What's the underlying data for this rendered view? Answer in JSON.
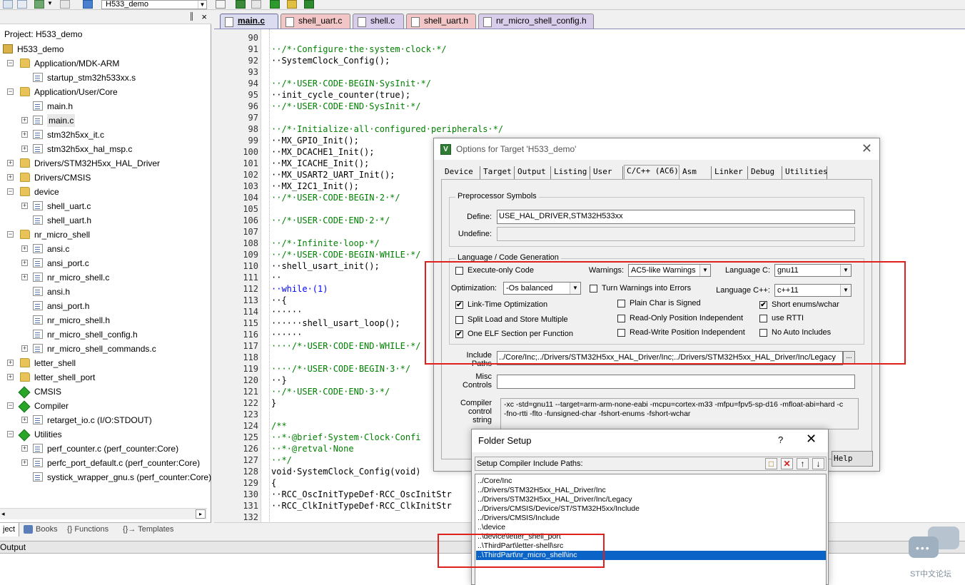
{
  "toolbar": {
    "target_combo": "H533_demo"
  },
  "project_pane": {
    "pin": "║",
    "close": "×",
    "title": "Project: H533_demo",
    "tree": [
      {
        "label": "H533_demo",
        "indent": 0,
        "icon": "project-icon",
        "expander": ""
      },
      {
        "label": "Application/MDK-ARM",
        "indent": 1,
        "icon": "folder-icon",
        "expander": "−"
      },
      {
        "label": "startup_stm32h533xx.s",
        "indent": 2,
        "icon": "file-icon",
        "expander": ""
      },
      {
        "label": "Application/User/Core",
        "indent": 1,
        "icon": "folder-icon",
        "expander": "−"
      },
      {
        "label": "main.h",
        "indent": 2,
        "icon": "file-icon",
        "expander": ""
      },
      {
        "label": "main.c",
        "indent": 2,
        "icon": "file-icon",
        "expander": "+",
        "selected": true
      },
      {
        "label": "stm32h5xx_it.c",
        "indent": 2,
        "icon": "file-icon",
        "expander": "+"
      },
      {
        "label": "stm32h5xx_hal_msp.c",
        "indent": 2,
        "icon": "file-icon",
        "expander": "+"
      },
      {
        "label": "Drivers/STM32H5xx_HAL_Driver",
        "indent": 1,
        "icon": "folder-icon",
        "expander": "+"
      },
      {
        "label": "Drivers/CMSIS",
        "indent": 1,
        "icon": "folder-icon",
        "expander": "+"
      },
      {
        "label": "device",
        "indent": 1,
        "icon": "folder-icon",
        "expander": "−"
      },
      {
        "label": "shell_uart.c",
        "indent": 2,
        "icon": "file-icon",
        "expander": "+"
      },
      {
        "label": "shell_uart.h",
        "indent": 2,
        "icon": "file-icon",
        "expander": ""
      },
      {
        "label": "nr_micro_shell",
        "indent": 1,
        "icon": "folder-icon",
        "expander": "−"
      },
      {
        "label": "ansi.c",
        "indent": 2,
        "icon": "file-icon",
        "expander": "+"
      },
      {
        "label": "ansi_port.c",
        "indent": 2,
        "icon": "file-icon",
        "expander": "+"
      },
      {
        "label": "nr_micro_shell.c",
        "indent": 2,
        "icon": "file-icon",
        "expander": "+"
      },
      {
        "label": "ansi.h",
        "indent": 2,
        "icon": "file-icon",
        "expander": ""
      },
      {
        "label": "ansi_port.h",
        "indent": 2,
        "icon": "file-icon",
        "expander": ""
      },
      {
        "label": "nr_micro_shell.h",
        "indent": 2,
        "icon": "file-icon",
        "expander": ""
      },
      {
        "label": "nr_micro_shell_config.h",
        "indent": 2,
        "icon": "file-icon",
        "expander": ""
      },
      {
        "label": "nr_micro_shell_commands.c",
        "indent": 2,
        "icon": "file-icon",
        "expander": "+"
      },
      {
        "label": "letter_shell",
        "indent": 1,
        "icon": "folder-icon",
        "expander": "+"
      },
      {
        "label": "letter_shell_port",
        "indent": 1,
        "icon": "folder-icon",
        "expander": "+"
      },
      {
        "label": "CMSIS",
        "indent": 1,
        "icon": "diamond-icon",
        "expander": ""
      },
      {
        "label": "Compiler",
        "indent": 1,
        "icon": "diamond-icon",
        "expander": "−"
      },
      {
        "label": "retarget_io.c (I/O:STDOUT)",
        "indent": 2,
        "icon": "file-icon",
        "expander": "+"
      },
      {
        "label": "Utilities",
        "indent": 1,
        "icon": "diamond-icon",
        "expander": "−"
      },
      {
        "label": "perf_counter.c (perf_counter:Core)",
        "indent": 2,
        "icon": "file-icon",
        "expander": "+"
      },
      {
        "label": "perfc_port_default.c (perf_counter:Core)",
        "indent": 2,
        "icon": "file-icon",
        "expander": "+"
      },
      {
        "label": "systick_wrapper_gnu.s (perf_counter:Core)",
        "indent": 2,
        "icon": "file-icon",
        "expander": ""
      }
    ],
    "bottom_tabs": [
      "ject",
      "Books",
      "{} Functions",
      "{}→ Templates"
    ]
  },
  "output": {
    "label": "Output"
  },
  "editor": {
    "tabs": [
      "main.c",
      "shell_uart.c",
      "shell.c",
      "shell_uart.h",
      "nr_micro_shell_config.h"
    ],
    "tab_colors": [
      "#dcdcf0",
      "#f2c6c6",
      "#d8cdea",
      "#f2c6c6",
      "#d8cdea"
    ],
    "lines": [
      {
        "n": "90",
        "t": ""
      },
      {
        "n": "91",
        "t": "··/*·Configure·the·system·clock·*/",
        "c": "cm"
      },
      {
        "n": "92",
        "t": "··SystemClock_Config();"
      },
      {
        "n": "93",
        "t": ""
      },
      {
        "n": "94",
        "t": "··/*·USER·CODE·BEGIN·SysInit·*/",
        "c": "cm"
      },
      {
        "n": "95",
        "t": "··init_cycle_counter(true);"
      },
      {
        "n": "96",
        "t": "··/*·USER·CODE·END·SysInit·*/",
        "c": "cm"
      },
      {
        "n": "97",
        "t": ""
      },
      {
        "n": "98",
        "t": "··/*·Initialize·all·configured·peripherals·*/",
        "c": "cm"
      },
      {
        "n": "99",
        "t": "··MX_GPIO_Init();"
      },
      {
        "n": "100",
        "t": "··MX_DCACHE1_Init();"
      },
      {
        "n": "101",
        "t": "··MX_ICACHE_Init();"
      },
      {
        "n": "102",
        "t": "··MX_USART2_UART_Init();"
      },
      {
        "n": "103",
        "t": "··MX_I2C1_Init();"
      },
      {
        "n": "104",
        "t": "··/*·USER·CODE·BEGIN·2·*/",
        "c": "cm"
      },
      {
        "n": "105",
        "t": ""
      },
      {
        "n": "106",
        "t": "··/*·USER·CODE·END·2·*/",
        "c": "cm"
      },
      {
        "n": "107",
        "t": ""
      },
      {
        "n": "108",
        "t": "··/*·Infinite·loop·*/",
        "c": "cm"
      },
      {
        "n": "109",
        "t": "··/*·USER·CODE·BEGIN·WHILE·*/",
        "c": "cm"
      },
      {
        "n": "110",
        "t": "··shell_usart_init();"
      },
      {
        "n": "111",
        "t": "··"
      },
      {
        "n": "112",
        "t": "··while·(1)",
        "c": "kw"
      },
      {
        "n": "113",
        "t": "··{"
      },
      {
        "n": "114",
        "t": "······"
      },
      {
        "n": "115",
        "t": "······shell_usart_loop();"
      },
      {
        "n": "116",
        "t": "······"
      },
      {
        "n": "117",
        "t": "····/*·USER·CODE·END·WHILE·*/",
        "c": "cm"
      },
      {
        "n": "118",
        "t": ""
      },
      {
        "n": "119",
        "t": "····/*·USER·CODE·BEGIN·3·*/",
        "c": "cm"
      },
      {
        "n": "120",
        "t": "··}"
      },
      {
        "n": "121",
        "t": "··/*·USER·CODE·END·3·*/",
        "c": "cm"
      },
      {
        "n": "122",
        "t": "}"
      },
      {
        "n": "123",
        "t": ""
      },
      {
        "n": "124",
        "t": "/**",
        "c": "cm"
      },
      {
        "n": "125",
        "t": "··*·@brief·System·Clock·Confi",
        "c": "cm"
      },
      {
        "n": "126",
        "t": "··*·@retval·None",
        "c": "cm"
      },
      {
        "n": "127",
        "t": "··*/",
        "c": "cm"
      },
      {
        "n": "128",
        "t": "void·SystemClock_Config(void)"
      },
      {
        "n": "129",
        "t": "{"
      },
      {
        "n": "130",
        "t": "··RCC_OscInitTypeDef·RCC_OscInitStr"
      },
      {
        "n": "131",
        "t": "··RCC_ClkInitTypeDef·RCC_ClkInitStr"
      },
      {
        "n": "132",
        "t": ""
      }
    ]
  },
  "options_dialog": {
    "title": "Options for Target 'H533_demo'",
    "close": "✕",
    "tabs": [
      "Device",
      "Target",
      "Output",
      "Listing",
      "User",
      "C/C++ (AC6)",
      "Asm",
      "Linker",
      "Debug",
      "Utilities"
    ],
    "active_tab": 5,
    "preprocessor": {
      "group_label": "Preprocessor Symbols",
      "define_label": "Define:",
      "define_value": "USE_HAL_DRIVER,STM32H533xx",
      "undefine_label": "Undefine:",
      "undefine_value": ""
    },
    "language": {
      "group_label": "Language / Code Generation",
      "execute_only": {
        "label": "Execute-only Code",
        "checked": false
      },
      "warnings_label": "Warnings:",
      "warnings_value": "AC5-like Warnings",
      "language_c_label": "Language C:",
      "language_c_value": "gnu11",
      "optimization_label": "Optimization:",
      "optimization_value": "-Os balanced",
      "turn_warnings_errors": {
        "label": "Turn Warnings into Errors",
        "checked": false
      },
      "language_cpp_label": "Language C++:",
      "language_cpp_value": "c++11",
      "link_time": {
        "label": "Link-Time Optimization",
        "checked": true
      },
      "plain_char": {
        "label": "Plain Char is Signed",
        "checked": false
      },
      "short_enums": {
        "label": "Short enums/wchar",
        "checked": true
      },
      "split_load": {
        "label": "Split Load and Store Multiple",
        "checked": false
      },
      "ropi": {
        "label": "Read-Only Position Independent",
        "checked": false
      },
      "use_rtti": {
        "label": "use RTTI",
        "checked": false
      },
      "one_elf": {
        "label": "One ELF Section per Function",
        "checked": true
      },
      "rwpi": {
        "label": "Read-Write Position Independent",
        "checked": false
      },
      "no_auto_includes": {
        "label": "No Auto Includes",
        "checked": false
      }
    },
    "include_paths_label": "Include\nPaths",
    "include_paths_value": "../Core/Inc;../Drivers/STM32H5xx_HAL_Driver/Inc;../Drivers/STM32H5xx_HAL_Driver/Inc/Legacy",
    "browse": "...",
    "misc_label": "Misc\nControls",
    "misc_value": "",
    "compiler_string_label": "Compiler\ncontrol\nstring",
    "compiler_string_value": "-xc -std=gnu11 --target=arm-arm-none-eabi -mcpu=cortex-m33 -mfpu=fpv5-sp-d16 -mfloat-abi=hard -c\n-fno-rtti -flto -funsigned-char -fshort-enums -fshort-wchar",
    "help_label": "Help"
  },
  "folder_setup": {
    "title": "Folder Setup",
    "help": "?",
    "close": "✕",
    "bar_label": "Setup Compiler Include Paths:",
    "buttons": {
      "new": "□",
      "delete": "✕",
      "up": "↑",
      "down": "↓"
    },
    "paths": [
      "../Core/Inc",
      "../Drivers/STM32H5xx_HAL_Driver/Inc",
      "../Drivers/STM32H5xx_HAL_Driver/Inc/Legacy",
      "../Drivers/CMSIS/Device/ST/STM32H5xx/Include",
      "../Drivers/CMSIS/Include",
      "..\\device",
      "..\\device\\letter_shell_port",
      "..\\ThirdPart\\letter-shell\\src",
      "..\\ThirdPart\\nr_micro_shell\\inc"
    ],
    "selected_index": 8
  },
  "watermark": {
    "text": "ST中文论坛"
  },
  "colors": {
    "highlight_red": "#e0201c",
    "selection_blue": "#0a64c8",
    "comment_green": "#008000",
    "keyword_blue": "#0000ff"
  }
}
